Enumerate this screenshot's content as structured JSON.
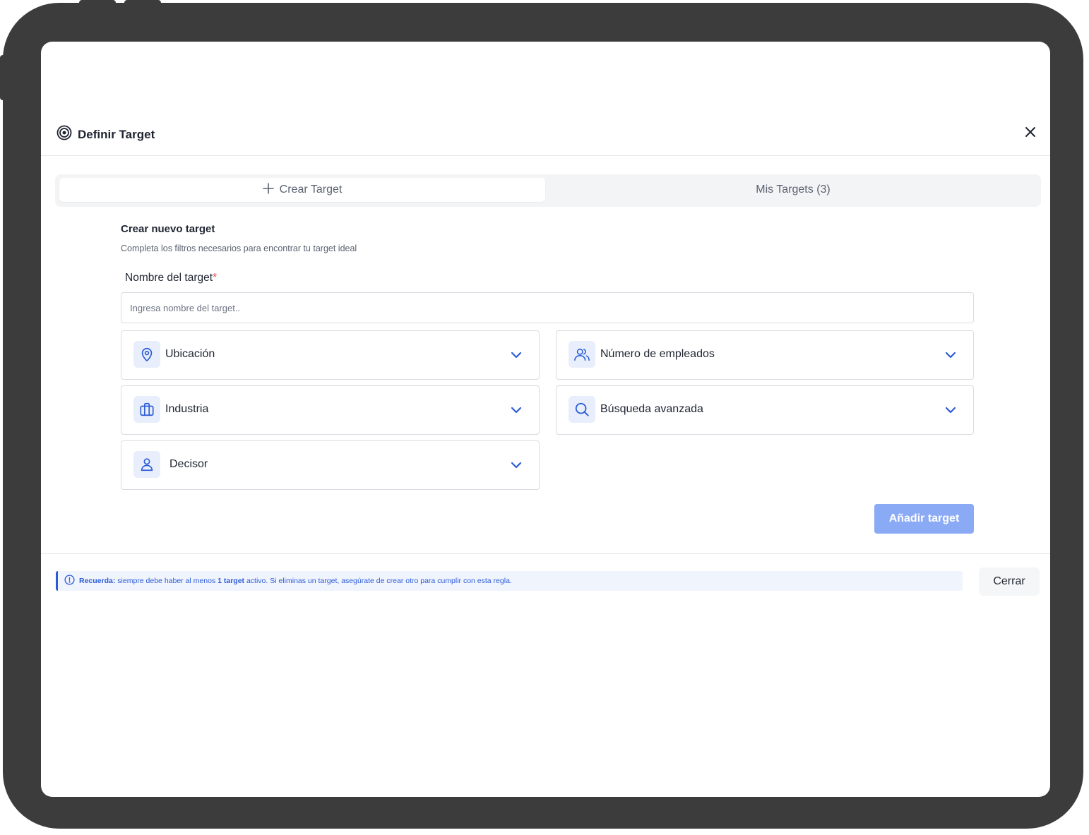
{
  "modal": {
    "title": "Definir Target",
    "tabs": [
      {
        "label": "Crear Target",
        "icon": "plus-icon",
        "active": true
      },
      {
        "label": "Mis Targets (3)",
        "active": false
      }
    ],
    "section": {
      "title": "Crear nuevo target",
      "subtitle": "Completa los filtros necesarios para encontrar tu target ideal"
    },
    "name_field": {
      "label": "Nombre del target",
      "required_mark": "*",
      "placeholder": "Ingresa nombre del target..",
      "value": ""
    },
    "filters": [
      {
        "label": "Ubicación",
        "icon": "location-pin-icon"
      },
      {
        "label": "Número de empleados",
        "icon": "users-icon"
      },
      {
        "label": "Industria",
        "icon": "briefcase-icon"
      },
      {
        "label": "Búsqueda avanzada",
        "icon": "search-icon"
      },
      {
        "label": "Decisor",
        "icon": "user-icon"
      }
    ],
    "add_button": "Añadir target",
    "notice": {
      "prefix": "Recuerda:",
      "text1": " siempre debe haber al menos ",
      "bold": "1 target",
      "text2": " activo. Si eliminas un target, asegúrate de crear otro para cumplir con esta regla."
    },
    "close_button": "Cerrar"
  },
  "colors": {
    "accent": "#2b5cd6",
    "button_disabled": "#8aaaf5",
    "icon_bg": "#e8eefb",
    "required": "#e5484d",
    "frame": "#3c3c3c"
  }
}
